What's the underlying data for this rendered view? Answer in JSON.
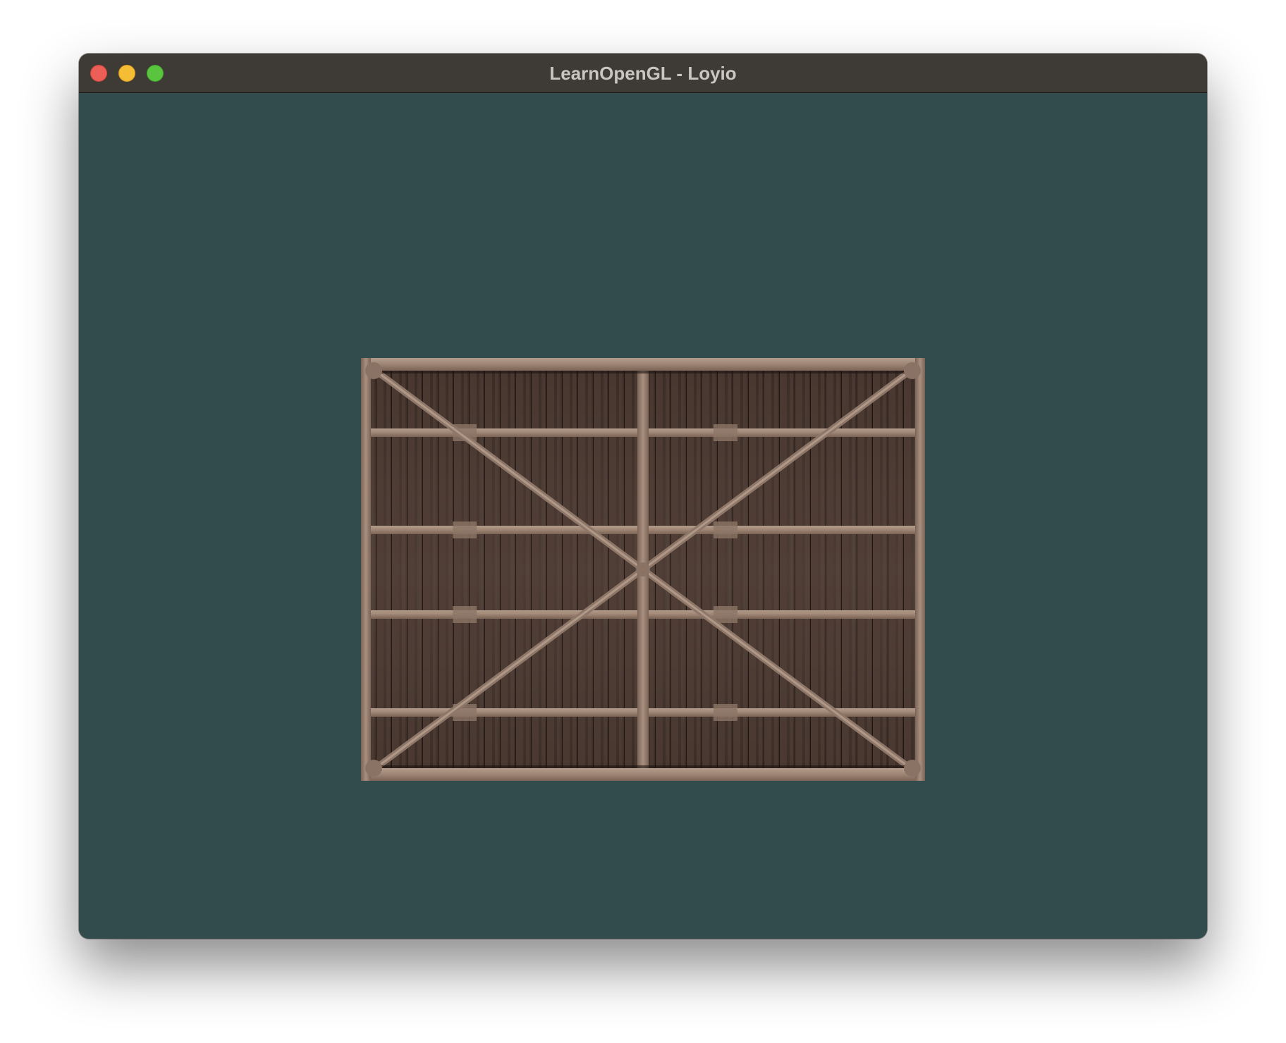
{
  "window": {
    "title": "LearnOpenGL - Loyio",
    "clear_color": "#324b4d",
    "titlebar_color": "#3e3a35"
  },
  "titlebar": {
    "buttons": [
      {
        "name": "close",
        "color": "#ec5f57"
      },
      {
        "name": "minimize",
        "color": "#f4bd34"
      },
      {
        "name": "maximize",
        "color": "#5ac43f"
      }
    ]
  },
  "viewport": {
    "texture": "wooden-crate-texture",
    "texture_colors": {
      "planks": "#4a3a30",
      "beams": "#9b8274"
    }
  }
}
